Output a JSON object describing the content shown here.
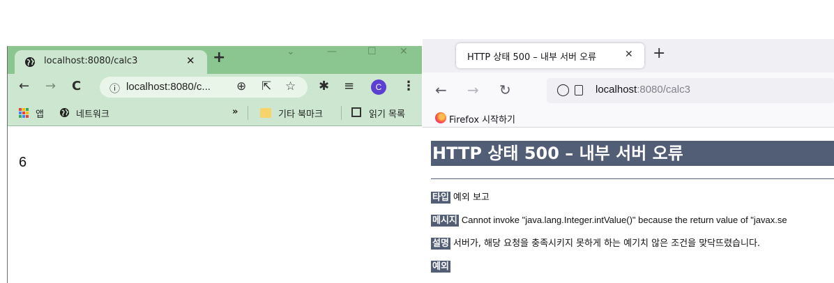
{
  "chrome": {
    "tab_title": "localhost:8080/calc3",
    "address": "localhost:8080/c...",
    "profile_initial": "C",
    "bookmarks": {
      "apps": "앱",
      "network": "네트워크",
      "overflow": "»",
      "other": "기타 북마크",
      "reading_list": "읽기 목록"
    },
    "page_text": "6"
  },
  "firefox": {
    "tab_title": "HTTP 상태 500 – 내부 서버 오류",
    "url_host": "localhost",
    "url_rest": ":8080/calc3",
    "bookmark_label": "Firefox 시작하기",
    "page": {
      "heading": "HTTP 상태 500 – 내부 서버 오류",
      "type_label": "타입",
      "type_value": "예외 보고",
      "message_label": "메시지",
      "message_value": "Cannot invoke \"java.lang.Integer.intValue()\" because the return value of \"javax.se",
      "description_label": "설명",
      "description_value": "서버가, 해당 요청을 충족시키지 못하게 하는 예기치 않은 조건을 맞닥뜨렸습니다.",
      "exception_label": "예외"
    }
  },
  "colors": {
    "chrome_tabbar": "#8bc58f",
    "chrome_toolbar": "#cde6cf",
    "tomcat_header": "#525d76",
    "chrome_avatar": "#5b3fd1"
  }
}
